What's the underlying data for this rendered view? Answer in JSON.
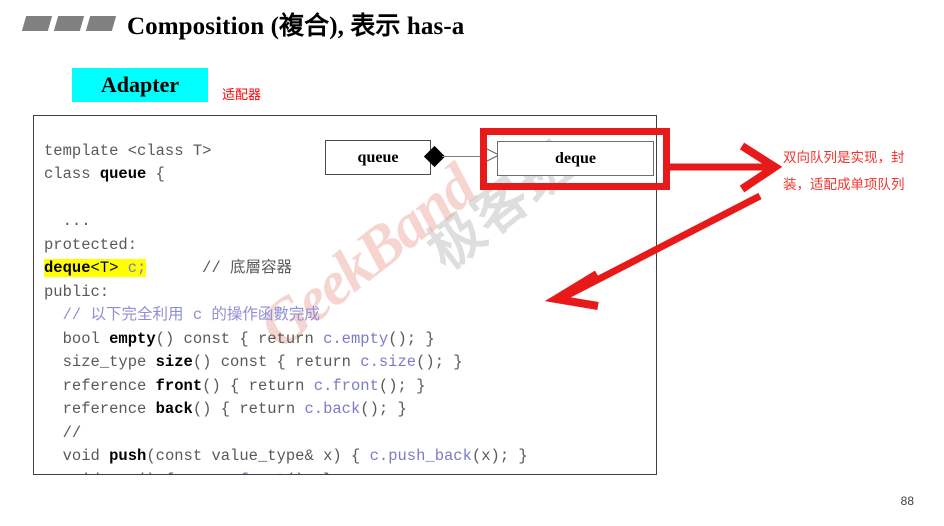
{
  "slide": {
    "title": "Composition (複合), 表示 has-a",
    "page_number": "88",
    "bullet_count": 3
  },
  "adapter": {
    "label": "Adapter",
    "cn_label": "适配器",
    "badge_color": "#00ffff",
    "cn_color": "#ff0000"
  },
  "code": {
    "lines": [
      "template <class T>",
      "class queue {",
      "  ...",
      "protected:",
      " deque<T> c;      // 底層容器",
      "public:",
      "  // 以下完全利用 c 的操作函數完成",
      "  bool empty() const { return c.empty(); }",
      "  size_type size() const { return c.size(); }",
      "  reference front() { return c.front(); }",
      "  reference back() { return c.back(); }",
      "  //",
      "  void push(const value_type& x) { c.push_back(x); }",
      "  void pop() { c.pop_front(); }",
      "};"
    ],
    "highlighted_line": " deque<T> c;",
    "highlight_color": "#ffff00",
    "member_call_color": "#7b7bc8",
    "base_color": "#595959"
  },
  "diagram": {
    "source_box": "queue",
    "target_box": "deque",
    "relation": "composition",
    "highlight_color": "#e81919"
  },
  "annotation": {
    "line1": "双向队列是实现，封",
    "line2": "装，适配成单项队列",
    "color": "#f0352e"
  },
  "watermark": {
    "text_en": "GeekBand",
    "text_cn": "极客班"
  },
  "icons": {
    "bullet": "bullet-parallelogram-icon",
    "diamond": "composition-diamond-icon",
    "arrowhead": "open-arrowhead-icon"
  }
}
